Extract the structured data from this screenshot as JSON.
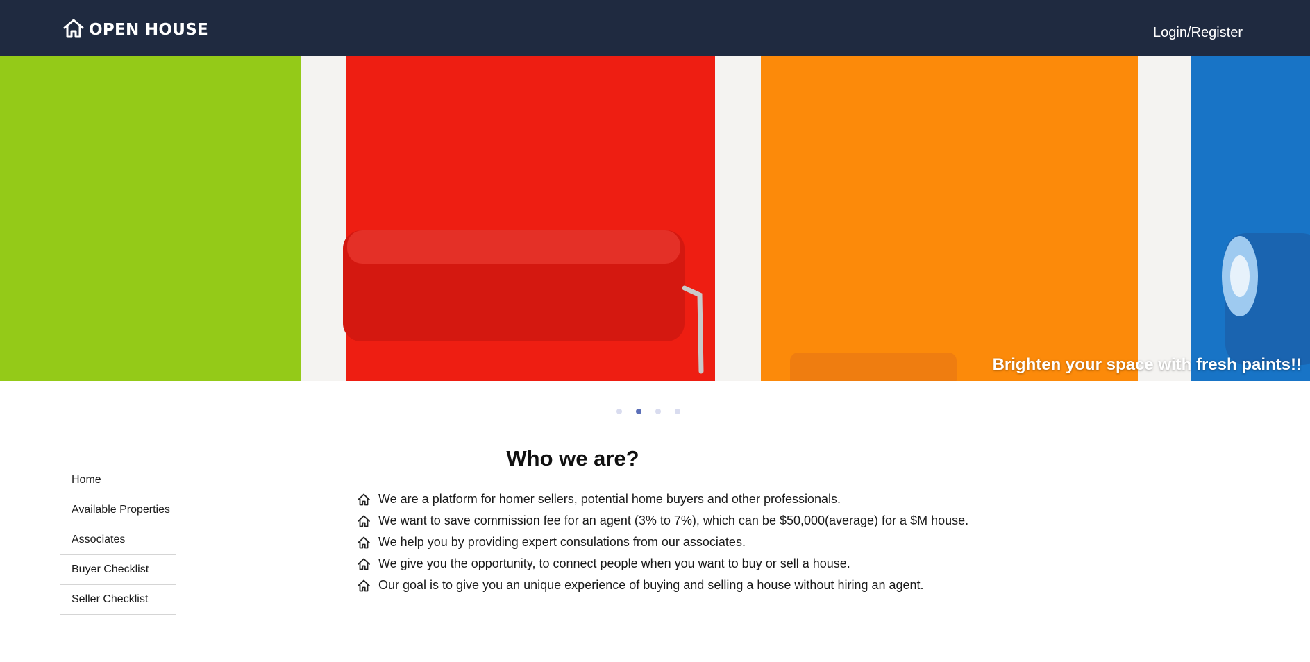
{
  "navbar": {
    "brand_icon": "house-outline-icon",
    "brand": "OPEN HOUSE",
    "login": "Login/Register",
    "background": "#1f2a40"
  },
  "hero": {
    "caption": "Brighten your space with fresh paints!!",
    "slides_count": 4,
    "active_slide": 2
  },
  "sidebar": {
    "items": [
      "Home",
      "Available Properties",
      "Associates",
      "Buyer Checklist",
      "Seller Checklist"
    ]
  },
  "about": {
    "title": "Who we are?",
    "bullet_icon": "house-outline-icon",
    "items": [
      "We are a platform for homer sellers, potential home buyers and other professionals.",
      "We want to save commission fee for an agent (3% to 7%), which can be $50,000(average) for a $M house.",
      "We help you by providing expert consulations from our associates.",
      "We give you the opportunity, to connect people when you want to buy or sell a house.",
      "Our goal is to give you an unique experience of buying and selling a house without hiring an agent."
    ]
  },
  "colors": {
    "paint_green": "#97cd1a",
    "paint_red": "#ee1e12",
    "paint_orange": "#fc8a0a",
    "paint_blue": "#1874c6",
    "dot_active": "#5b6fb8",
    "dot_inactive": "#d9dcef"
  }
}
